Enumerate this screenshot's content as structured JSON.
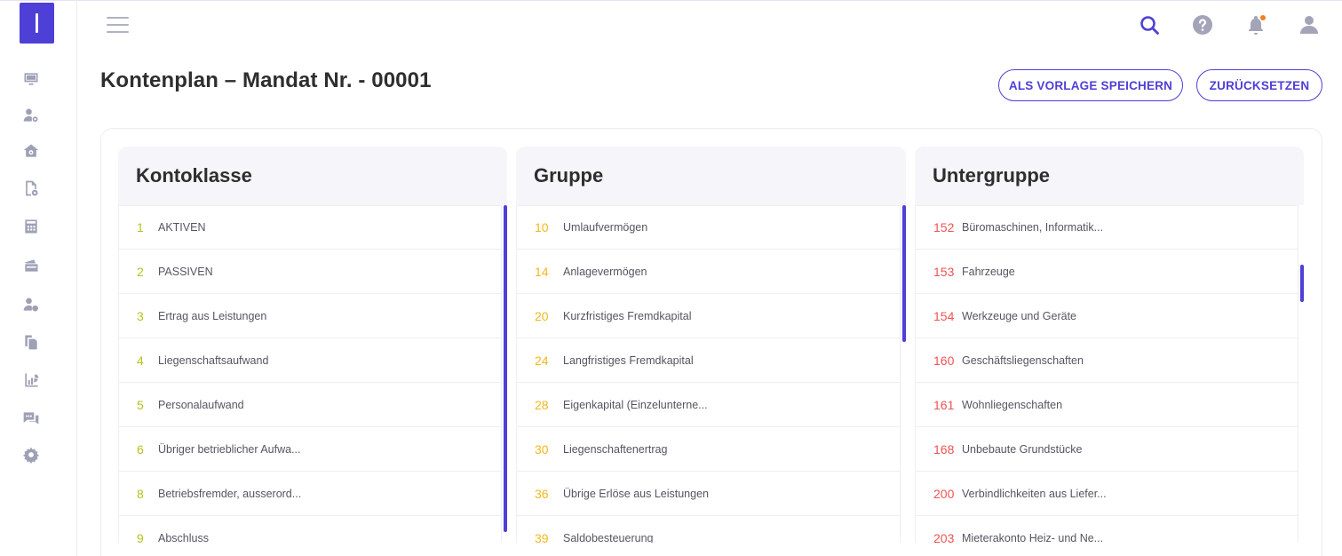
{
  "page": {
    "title": "Kontenplan – Mandat Nr. - 00001"
  },
  "header": {
    "save_template_label": "ALS VORLAGE SPEICHERN",
    "reset_label": "ZURÜCKSETZEN",
    "accent_color": "#4e3fd6",
    "notification_dot_color": "#f0801c"
  },
  "sidebar": {
    "icons": [
      "monitor-icon",
      "user-settings-icon",
      "home-settings-icon",
      "document-settings-icon",
      "calculator-icon",
      "cards-icon",
      "user-clock-icon",
      "documents-icon",
      "report-chart-icon",
      "chat-icon",
      "gear-icon"
    ]
  },
  "columns": [
    {
      "title": "Kontoklasse",
      "num_color": "#b5c21d",
      "rows": [
        {
          "num": "1",
          "label": "AKTIVEN"
        },
        {
          "num": "2",
          "label": "PASSIVEN"
        },
        {
          "num": "3",
          "label": "Ertrag aus Leistungen"
        },
        {
          "num": "4",
          "label": "Liegenschaftsaufwand"
        },
        {
          "num": "5",
          "label": "Personalaufwand"
        },
        {
          "num": "6",
          "label": "Übriger betrieblicher Aufwa..."
        },
        {
          "num": "8",
          "label": "Betriebsfremder, ausserord..."
        },
        {
          "num": "9",
          "label": "Abschluss"
        }
      ]
    },
    {
      "title": "Gruppe",
      "num_color": "#f2b71c",
      "rows": [
        {
          "num": "10",
          "label": "Umlaufvermögen"
        },
        {
          "num": "14",
          "label": "Anlagevermögen"
        },
        {
          "num": "20",
          "label": "Kurzfristiges Fremdkapital"
        },
        {
          "num": "24",
          "label": "Langfristiges Fremdkapital"
        },
        {
          "num": "28",
          "label": "Eigenkapital (Einzelunterne..."
        },
        {
          "num": "30",
          "label": "Liegenschaftenertrag"
        },
        {
          "num": "36",
          "label": "Übrige Erlöse aus Leistungen"
        },
        {
          "num": "39",
          "label": "Saldobesteuerung"
        }
      ]
    },
    {
      "title": "Untergruppe",
      "num_color": "#ee5353",
      "rows": [
        {
          "num": "152",
          "label": "Büromaschinen, Informatik..."
        },
        {
          "num": "153",
          "label": "Fahrzeuge"
        },
        {
          "num": "154",
          "label": "Werkzeuge und Geräte"
        },
        {
          "num": "160",
          "label": "Geschäftsliegenschaften"
        },
        {
          "num": "161",
          "label": "Wohnliegenschaften"
        },
        {
          "num": "168",
          "label": "Unbebaute Grundstücke"
        },
        {
          "num": "200",
          "label": "Verbindlichkeiten aus Liefer..."
        },
        {
          "num": "203",
          "label": "Mieterakonto Heiz- und Ne..."
        }
      ]
    }
  ]
}
